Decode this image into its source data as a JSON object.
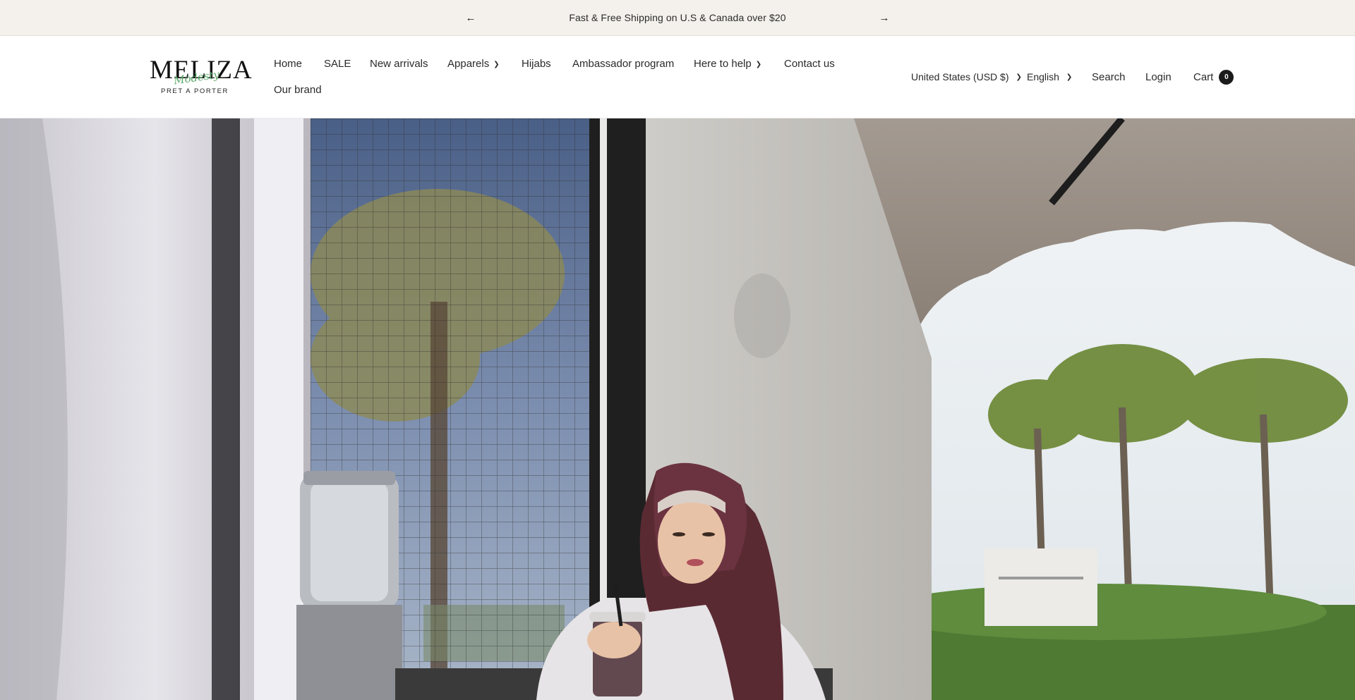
{
  "announcement": {
    "prev_icon": "arrow-left-icon",
    "next_icon": "arrow-right-icon",
    "message": "Fast & Free Shipping on U.S & Canada over $20"
  },
  "logo": {
    "wordmark": "MELIZA",
    "script": "Modesty",
    "tagline": "PRET A PORTER"
  },
  "nav": {
    "items": [
      {
        "label": "Home"
      },
      {
        "label": "SALE"
      },
      {
        "label": "New arrivals"
      },
      {
        "label": "Apparels",
        "has_dropdown": true
      },
      {
        "label": "Hijabs"
      },
      {
        "label": "Ambassador program"
      },
      {
        "label": "Here to help",
        "has_dropdown": true
      },
      {
        "label": "Contact us"
      },
      {
        "label": "Our brand"
      }
    ]
  },
  "utils": {
    "currency": "United States (USD $)",
    "language": "English",
    "search": "Search",
    "login": "Login",
    "cart": "Cart",
    "cart_count": "0"
  },
  "colors": {
    "announcement_bg": "#f4f1ec",
    "text": "#1c1b1b",
    "logo_accent": "#5aa86a",
    "hijab": "#5a2a33"
  }
}
